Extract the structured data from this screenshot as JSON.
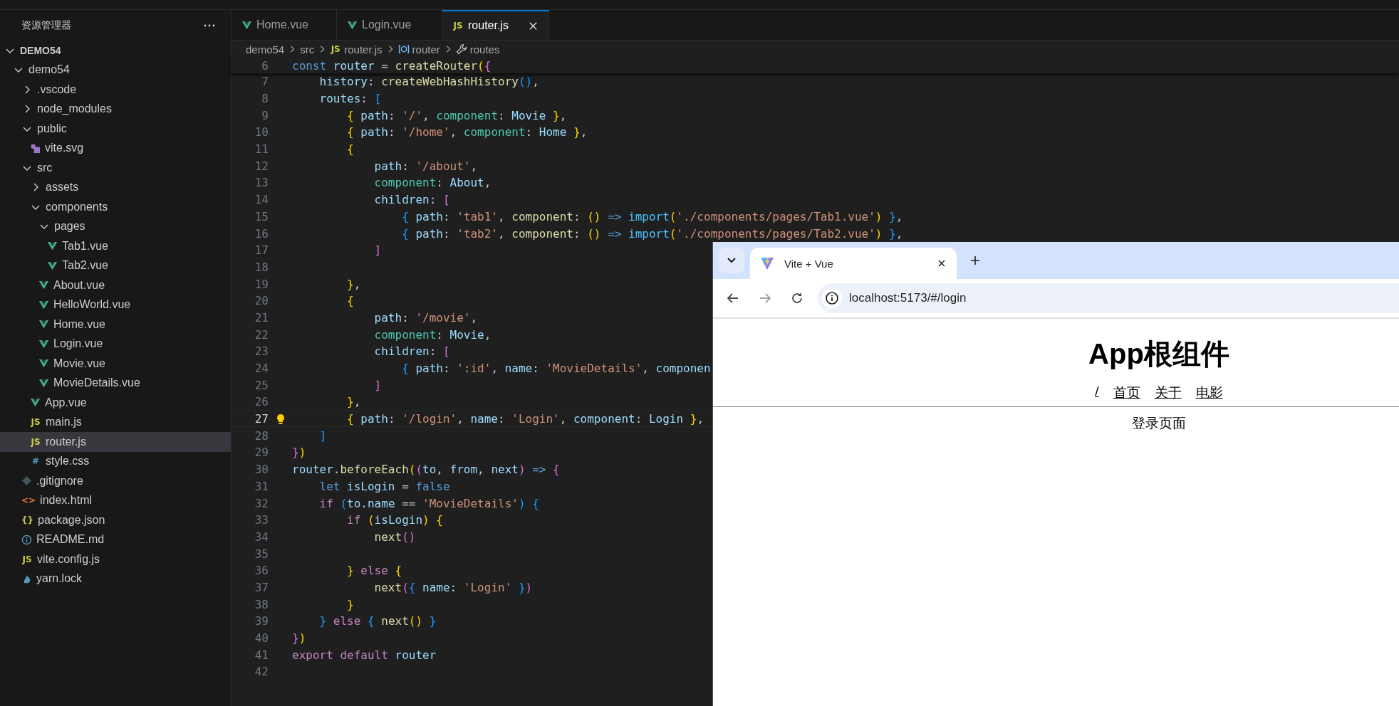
{
  "sidebar": {
    "title": "资源管理器",
    "tree": [
      {
        "name": "DEMO54",
        "kind": "folder",
        "expanded": true,
        "selected": false,
        "children": [
          {
            "name": "demo54",
            "kind": "folder",
            "expanded": true,
            "selected": false,
            "children": [
              {
                "name": ".vscode",
                "kind": "folder",
                "expanded": false,
                "selected": false
              },
              {
                "name": "node_modules",
                "kind": "folder",
                "expanded": false,
                "selected": false
              },
              {
                "name": "public",
                "kind": "folder",
                "expanded": true,
                "selected": false,
                "children": [
                  {
                    "name": "vite.svg",
                    "kind": "svg",
                    "selected": false
                  }
                ]
              },
              {
                "name": "src",
                "kind": "folder",
                "expanded": true,
                "selected": false,
                "children": [
                  {
                    "name": "assets",
                    "kind": "folder",
                    "expanded": false,
                    "selected": false
                  },
                  {
                    "name": "components",
                    "kind": "folder",
                    "expanded": true,
                    "selected": false,
                    "children": [
                      {
                        "name": "pages",
                        "kind": "folder",
                        "expanded": true,
                        "selected": false,
                        "children": [
                          {
                            "name": "Tab1.vue",
                            "kind": "vue",
                            "selected": false
                          },
                          {
                            "name": "Tab2.vue",
                            "kind": "vue",
                            "selected": false
                          }
                        ]
                      },
                      {
                        "name": "About.vue",
                        "kind": "vue",
                        "selected": false
                      },
                      {
                        "name": "HelloWorld.vue",
                        "kind": "vue",
                        "selected": false
                      },
                      {
                        "name": "Home.vue",
                        "kind": "vue",
                        "selected": false
                      },
                      {
                        "name": "Login.vue",
                        "kind": "vue",
                        "selected": false
                      },
                      {
                        "name": "Movie.vue",
                        "kind": "vue",
                        "selected": false
                      },
                      {
                        "name": "MovieDetails.vue",
                        "kind": "vue",
                        "selected": false
                      }
                    ]
                  },
                  {
                    "name": "App.vue",
                    "kind": "vue",
                    "selected": false
                  },
                  {
                    "name": "main.js",
                    "kind": "js",
                    "glyph": "JS",
                    "selected": false
                  },
                  {
                    "name": "router.js",
                    "kind": "js",
                    "glyph": "JS",
                    "selected": true
                  },
                  {
                    "name": "style.css",
                    "kind": "css",
                    "glyph": "#",
                    "selected": false
                  }
                ]
              },
              {
                "name": ".gitignore",
                "kind": "git",
                "selected": false
              },
              {
                "name": "index.html",
                "kind": "html",
                "glyph": "<>",
                "selected": false
              },
              {
                "name": "package.json",
                "kind": "json",
                "glyph": "{}",
                "selected": false
              },
              {
                "name": "README.md",
                "kind": "info",
                "selected": false
              },
              {
                "name": "vite.config.js",
                "kind": "js",
                "glyph": "JS",
                "selected": false
              },
              {
                "name": "yarn.lock",
                "kind": "yarn",
                "selected": false
              }
            ]
          }
        ]
      }
    ]
  },
  "editor": {
    "tabs": [
      {
        "label": "Home.vue",
        "kind": "vue",
        "selected": false
      },
      {
        "label": "Login.vue",
        "kind": "vue",
        "selected": false
      },
      {
        "label": "router.js",
        "kind": "js",
        "glyph": "JS",
        "selected": true
      }
    ],
    "breadcrumb": [
      {
        "text": "demo54",
        "kind": "folder"
      },
      {
        "text": "src",
        "kind": "folder"
      },
      {
        "text": "router.js",
        "kind": "js",
        "glyph": "JS"
      },
      {
        "text": "router",
        "kind": "variable"
      },
      {
        "text": "routes",
        "kind": "wrench"
      }
    ],
    "sticky_line": {
      "number": "6",
      "tokens": [
        {
          "kind": "keyword",
          "text": "const "
        },
        {
          "kind": "variable",
          "text": "router"
        },
        {
          "kind": "plain",
          "text": " = "
        },
        {
          "kind": "function",
          "text": "createRouter"
        },
        {
          "kind": "bracket1",
          "text": "("
        },
        {
          "kind": "bracket2",
          "text": "{"
        }
      ]
    },
    "lines": [
      {
        "number": "7",
        "current": false,
        "tokens": [
          {
            "kind": "variable",
            "text": "    history"
          },
          {
            "kind": "plain",
            "text": ": "
          },
          {
            "kind": "function",
            "text": "createWebHashHistory"
          },
          {
            "kind": "bracket3",
            "text": "()"
          },
          {
            "kind": "plain",
            "text": ","
          }
        ]
      },
      {
        "number": "8",
        "current": false,
        "tokens": [
          {
            "kind": "variable",
            "text": "    routes"
          },
          {
            "kind": "plain",
            "text": ": "
          },
          {
            "kind": "bracket3",
            "text": "["
          }
        ]
      },
      {
        "number": "9",
        "current": false,
        "tokens": [
          {
            "kind": "bracket1",
            "text": "        {"
          },
          {
            "kind": "variable",
            "text": " path"
          },
          {
            "kind": "plain",
            "text": ": "
          },
          {
            "kind": "string",
            "text": "'/'"
          },
          {
            "kind": "plain",
            "text": ", "
          },
          {
            "kind": "type",
            "text": "component"
          },
          {
            "kind": "plain",
            "text": ": "
          },
          {
            "kind": "variable",
            "text": "Movie "
          },
          {
            "kind": "bracket1",
            "text": "}"
          },
          {
            "kind": "plain",
            "text": ","
          }
        ]
      },
      {
        "number": "10",
        "current": false,
        "tokens": [
          {
            "kind": "bracket1",
            "text": "        {"
          },
          {
            "kind": "variable",
            "text": " path"
          },
          {
            "kind": "plain",
            "text": ": "
          },
          {
            "kind": "string",
            "text": "'/home'"
          },
          {
            "kind": "plain",
            "text": ", "
          },
          {
            "kind": "type",
            "text": "component"
          },
          {
            "kind": "plain",
            "text": ": "
          },
          {
            "kind": "variable",
            "text": "Home "
          },
          {
            "kind": "bracket1",
            "text": "}"
          },
          {
            "kind": "plain",
            "text": ","
          }
        ]
      },
      {
        "number": "11",
        "current": false,
        "tokens": [
          {
            "kind": "bracket1",
            "text": "        {"
          }
        ]
      },
      {
        "number": "12",
        "current": false,
        "tokens": [
          {
            "kind": "variable",
            "text": "            path"
          },
          {
            "kind": "plain",
            "text": ": "
          },
          {
            "kind": "string",
            "text": "'/about'"
          },
          {
            "kind": "plain",
            "text": ","
          }
        ]
      },
      {
        "number": "13",
        "current": false,
        "tokens": [
          {
            "kind": "type",
            "text": "            component"
          },
          {
            "kind": "plain",
            "text": ": "
          },
          {
            "kind": "variable",
            "text": "About"
          },
          {
            "kind": "plain",
            "text": ","
          }
        ]
      },
      {
        "number": "14",
        "current": false,
        "tokens": [
          {
            "kind": "variable",
            "text": "            children"
          },
          {
            "kind": "plain",
            "text": ": "
          },
          {
            "kind": "bracket2",
            "text": "["
          }
        ]
      },
      {
        "number": "15",
        "current": false,
        "tokens": [
          {
            "kind": "bracket3",
            "text": "                {"
          },
          {
            "kind": "variable",
            "text": " path"
          },
          {
            "kind": "plain",
            "text": ": "
          },
          {
            "kind": "string",
            "text": "'tab1'"
          },
          {
            "kind": "plain",
            "text": ", "
          },
          {
            "kind": "function",
            "text": "component"
          },
          {
            "kind": "plain",
            "text": ": "
          },
          {
            "kind": "bracket1",
            "text": "()"
          },
          {
            "kind": "keyword",
            "text": " => "
          },
          {
            "kind": "import",
            "text": "import"
          },
          {
            "kind": "bracket1",
            "text": "("
          },
          {
            "kind": "string",
            "text": "'./components/pages/Tab1.vue'"
          },
          {
            "kind": "bracket1",
            "text": ")"
          },
          {
            "kind": "bracket3",
            "text": " }"
          },
          {
            "kind": "plain",
            "text": ","
          }
        ]
      },
      {
        "number": "16",
        "current": false,
        "tokens": [
          {
            "kind": "bracket3",
            "text": "                {"
          },
          {
            "kind": "variable",
            "text": " path"
          },
          {
            "kind": "plain",
            "text": ": "
          },
          {
            "kind": "string",
            "text": "'tab2'"
          },
          {
            "kind": "plain",
            "text": ", "
          },
          {
            "kind": "function",
            "text": "component"
          },
          {
            "kind": "plain",
            "text": ": "
          },
          {
            "kind": "bracket1",
            "text": "()"
          },
          {
            "kind": "keyword",
            "text": " => "
          },
          {
            "kind": "import",
            "text": "import"
          },
          {
            "kind": "bracket1",
            "text": "("
          },
          {
            "kind": "string",
            "text": "'./components/pages/Tab2.vue'"
          },
          {
            "kind": "bracket1",
            "text": ")"
          },
          {
            "kind": "bracket3",
            "text": " }"
          },
          {
            "kind": "plain",
            "text": ","
          }
        ]
      },
      {
        "number": "17",
        "current": false,
        "tokens": [
          {
            "kind": "bracket2",
            "text": "            ]"
          }
        ]
      },
      {
        "number": "18",
        "current": false
      },
      {
        "number": "19",
        "current": false,
        "tokens": [
          {
            "kind": "bracket1",
            "text": "        }"
          },
          {
            "kind": "plain",
            "text": ","
          }
        ]
      },
      {
        "number": "20",
        "current": false,
        "tokens": [
          {
            "kind": "bracket1",
            "text": "        {"
          }
        ]
      },
      {
        "number": "21",
        "current": false,
        "tokens": [
          {
            "kind": "variable",
            "text": "            path"
          },
          {
            "kind": "plain",
            "text": ": "
          },
          {
            "kind": "string",
            "text": "'/movie'"
          },
          {
            "kind": "plain",
            "text": ","
          }
        ]
      },
      {
        "number": "22",
        "current": false,
        "tokens": [
          {
            "kind": "type",
            "text": "            component"
          },
          {
            "kind": "plain",
            "text": ": "
          },
          {
            "kind": "variable",
            "text": "Movie"
          },
          {
            "kind": "plain",
            "text": ","
          }
        ]
      },
      {
        "number": "23",
        "current": false,
        "tokens": [
          {
            "kind": "variable",
            "text": "            children"
          },
          {
            "kind": "plain",
            "text": ": "
          },
          {
            "kind": "bracket2",
            "text": "["
          }
        ]
      },
      {
        "number": "24",
        "current": false,
        "tokens": [
          {
            "kind": "bracket3",
            "text": "                {"
          },
          {
            "kind": "variable",
            "text": " path"
          },
          {
            "kind": "plain",
            "text": ": "
          },
          {
            "kind": "string",
            "text": "':id'"
          },
          {
            "kind": "plain",
            "text": ", "
          },
          {
            "kind": "variable",
            "text": "name"
          },
          {
            "kind": "plain",
            "text": ": "
          },
          {
            "kind": "string",
            "text": "'MovieDetails'"
          },
          {
            "kind": "plain",
            "text": ", "
          },
          {
            "kind": "variable",
            "text": "componen"
          }
        ]
      },
      {
        "number": "25",
        "current": false,
        "tokens": [
          {
            "kind": "bracket2",
            "text": "            ]"
          }
        ]
      },
      {
        "number": "26",
        "current": false,
        "tokens": [
          {
            "kind": "bracket1",
            "text": "        }"
          },
          {
            "kind": "plain",
            "text": ","
          }
        ]
      },
      {
        "number": "27",
        "current": true,
        "tokens": [
          {
            "kind": "bracket1",
            "text": "        {"
          },
          {
            "kind": "variable",
            "text": " path"
          },
          {
            "kind": "plain",
            "text": ": "
          },
          {
            "kind": "string",
            "text": "'/login'"
          },
          {
            "kind": "plain",
            "text": ", "
          },
          {
            "kind": "variable",
            "text": "name"
          },
          {
            "kind": "plain",
            "text": ": "
          },
          {
            "kind": "string",
            "text": "'Login'"
          },
          {
            "kind": "plain",
            "text": ", "
          },
          {
            "kind": "variable",
            "text": "component"
          },
          {
            "kind": "plain",
            "text": ": "
          },
          {
            "kind": "variable",
            "text": "Login "
          },
          {
            "kind": "bracket1",
            "text": "}"
          },
          {
            "kind": "plain",
            "text": ","
          }
        ]
      },
      {
        "number": "28",
        "current": false,
        "tokens": [
          {
            "kind": "bracket3",
            "text": "    ]"
          }
        ]
      },
      {
        "number": "29",
        "current": false,
        "tokens": [
          {
            "kind": "bracket2",
            "text": "}"
          },
          {
            "kind": "bracket1",
            "text": ")"
          }
        ]
      },
      {
        "number": "30",
        "current": false,
        "tokens": [
          {
            "kind": "variable",
            "text": "router"
          },
          {
            "kind": "plain",
            "text": "."
          },
          {
            "kind": "function",
            "text": "beforeEach"
          },
          {
            "kind": "bracket1",
            "text": "("
          },
          {
            "kind": "bracket2",
            "text": "("
          },
          {
            "kind": "variable",
            "text": "to"
          },
          {
            "kind": "plain",
            "text": ", "
          },
          {
            "kind": "variable",
            "text": "from"
          },
          {
            "kind": "plain",
            "text": ", "
          },
          {
            "kind": "variable",
            "text": "next"
          },
          {
            "kind": "bracket2",
            "text": ")"
          },
          {
            "kind": "keyword",
            "text": " => "
          },
          {
            "kind": "bracket2",
            "text": "{"
          }
        ]
      },
      {
        "number": "31",
        "current": false,
        "tokens": [
          {
            "kind": "keyword",
            "text": "    let "
          },
          {
            "kind": "variable",
            "text": "isLogin"
          },
          {
            "kind": "plain",
            "text": " = "
          },
          {
            "kind": "keyword",
            "text": "false"
          }
        ]
      },
      {
        "number": "32",
        "current": false,
        "tokens": [
          {
            "kind": "control",
            "text": "    if "
          },
          {
            "kind": "bracket3",
            "text": "("
          },
          {
            "kind": "variable",
            "text": "to.name"
          },
          {
            "kind": "plain",
            "text": " == "
          },
          {
            "kind": "string",
            "text": "'MovieDetails'"
          },
          {
            "kind": "bracket3",
            "text": ")"
          },
          {
            "kind": "bracket3",
            "text": " {"
          }
        ]
      },
      {
        "number": "33",
        "current": false,
        "tokens": [
          {
            "kind": "control",
            "text": "        if "
          },
          {
            "kind": "bracket1",
            "text": "("
          },
          {
            "kind": "variable",
            "text": "isLogin"
          },
          {
            "kind": "bracket1",
            "text": ")"
          },
          {
            "kind": "bracket1",
            "text": " {"
          }
        ]
      },
      {
        "number": "34",
        "current": false,
        "tokens": [
          {
            "kind": "function",
            "text": "            next"
          },
          {
            "kind": "bracket2",
            "text": "()"
          }
        ]
      },
      {
        "number": "35",
        "current": false
      },
      {
        "number": "36",
        "current": false,
        "tokens": [
          {
            "kind": "bracket1",
            "text": "        }"
          },
          {
            "kind": "control",
            "text": " else "
          },
          {
            "kind": "bracket1",
            "text": "{"
          }
        ]
      },
      {
        "number": "37",
        "current": false,
        "tokens": [
          {
            "kind": "function",
            "text": "            next"
          },
          {
            "kind": "bracket2",
            "text": "("
          },
          {
            "kind": "bracket3",
            "text": "{"
          },
          {
            "kind": "variable",
            "text": " name"
          },
          {
            "kind": "plain",
            "text": ": "
          },
          {
            "kind": "string",
            "text": "'Login'"
          },
          {
            "kind": "bracket3",
            "text": " }"
          },
          {
            "kind": "bracket2",
            "text": ")"
          }
        ]
      },
      {
        "number": "38",
        "current": false,
        "tokens": [
          {
            "kind": "bracket1",
            "text": "        }"
          }
        ]
      },
      {
        "number": "39",
        "current": false,
        "tokens": [
          {
            "kind": "bracket3",
            "text": "    }"
          },
          {
            "kind": "control",
            "text": " else "
          },
          {
            "kind": "bracket3",
            "text": "{"
          },
          {
            "kind": "function",
            "text": " next"
          },
          {
            "kind": "bracket1",
            "text": "()"
          },
          {
            "kind": "bracket3",
            "text": " }"
          }
        ]
      },
      {
        "number": "40",
        "current": false,
        "tokens": [
          {
            "kind": "bracket2",
            "text": "}"
          },
          {
            "kind": "bracket1",
            "text": ")"
          }
        ]
      },
      {
        "number": "41",
        "current": false,
        "tokens": [
          {
            "kind": "control",
            "text": "export default "
          },
          {
            "kind": "variable",
            "text": "router"
          }
        ]
      },
      {
        "number": "42",
        "current": false
      }
    ]
  },
  "browser": {
    "tab": {
      "title": "Vite + Vue"
    },
    "nav_buttons": [
      {
        "kind": "back",
        "disabled": false
      },
      {
        "kind": "forward",
        "disabled": true
      },
      {
        "kind": "reload",
        "disabled": false
      }
    ],
    "url": "localhost:5173/#/login",
    "page": {
      "heading": "App根组件",
      "links": [
        "/",
        "首页",
        "关于",
        "电影"
      ],
      "content": "登录页面"
    }
  }
}
